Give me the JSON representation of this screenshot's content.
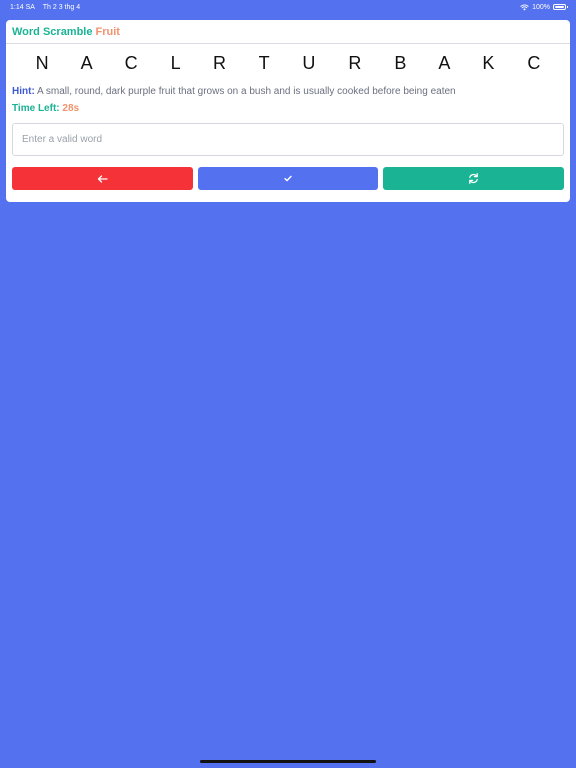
{
  "status_bar": {
    "time": "1:14 SA",
    "date": "Th 2 3 thg 4",
    "battery": "100%",
    "wifi_icon": "wifi-icon",
    "battery_icon": "battery-icon"
  },
  "header": {
    "title": "Word Scramble",
    "category": "Fruit"
  },
  "game": {
    "scrambled_word": "N A C L R T U R B A K C",
    "hint_label": "Hint:",
    "hint_text": "A small, round, dark purple fruit that grows on a bush and is usually cooked before being eaten",
    "time_label": "Time Left:",
    "time_value": "28s"
  },
  "input": {
    "value": "",
    "placeholder": "Enter a valid word"
  },
  "buttons": [
    {
      "name": "back-button",
      "icon": "arrow-left-icon",
      "color": "#f53237"
    },
    {
      "name": "check-button",
      "icon": "checkmark-icon",
      "color": "#5472f0"
    },
    {
      "name": "refresh-button",
      "icon": "refresh-icon",
      "color": "#1ab394"
    }
  ],
  "colors": {
    "background": "#5472f0",
    "accent_green": "#1ab394",
    "accent_orange": "#f0936e",
    "hint_blue": "#3c5ad8"
  }
}
